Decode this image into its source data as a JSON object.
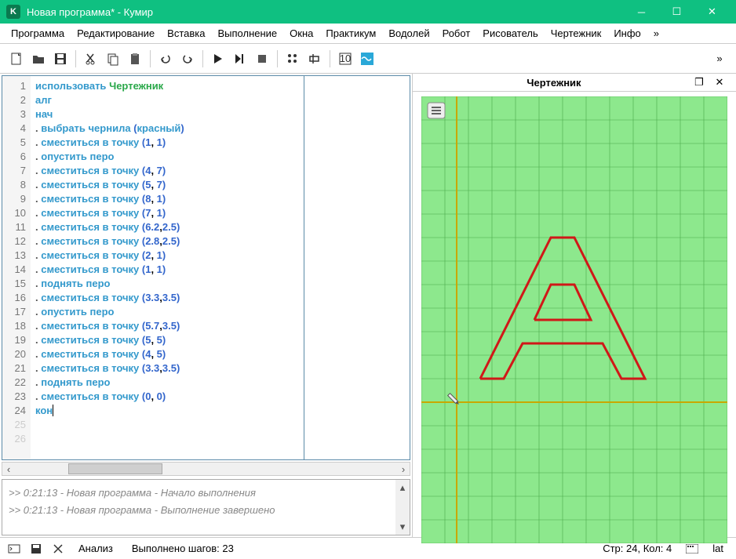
{
  "window": {
    "title": "Новая программа* - Кумир"
  },
  "menu": [
    "Программа",
    "Редактирование",
    "Вставка",
    "Выполнение",
    "Окна",
    "Практикум",
    "Водолей",
    "Робот",
    "Рисователь",
    "Чертежник",
    "Инфо",
    "»"
  ],
  "panel": {
    "title": "Чертежник"
  },
  "code_lines": [
    {
      "n": 1,
      "html": "<span class='kw'>использовать</span> <span class='kg'>Чертежник</span>"
    },
    {
      "n": 2,
      "html": "<span class='kw'>алг</span>"
    },
    {
      "n": 3,
      "html": "<span class='kw'>нач</span>"
    },
    {
      "n": 4,
      "html": "<span class='dot'>.</span> <span class='kw'>выбрать чернила</span> <span class='par'>(</span><span class='str'>красный</span><span class='par'>)</span>"
    },
    {
      "n": 5,
      "html": "<span class='dot'>.</span> <span class='kw'>сместиться в точку</span> <span class='par'>(</span><span class='num'>1</span>, <span class='num'>1</span><span class='par'>)</span>"
    },
    {
      "n": 6,
      "html": "<span class='dot'>.</span> <span class='kw'>опустить перо</span>"
    },
    {
      "n": 7,
      "html": "<span class='dot'>.</span> <span class='kw'>сместиться в точку</span> <span class='par'>(</span><span class='num'>4</span>, <span class='num'>7</span><span class='par'>)</span>"
    },
    {
      "n": 8,
      "html": "<span class='dot'>.</span> <span class='kw'>сместиться в точку</span> <span class='par'>(</span><span class='num'>5</span>, <span class='num'>7</span><span class='par'>)</span>"
    },
    {
      "n": 9,
      "html": "<span class='dot'>.</span> <span class='kw'>сместиться в точку</span> <span class='par'>(</span><span class='num'>8</span>, <span class='num'>1</span><span class='par'>)</span>"
    },
    {
      "n": 10,
      "html": "<span class='dot'>.</span> <span class='kw'>сместиться в точку</span> <span class='par'>(</span><span class='num'>7</span>, <span class='num'>1</span><span class='par'>)</span>"
    },
    {
      "n": 11,
      "html": "<span class='dot'>.</span> <span class='kw'>сместиться в точку</span> <span class='par'>(</span><span class='num'>6.2</span>,<span class='num'>2.5</span><span class='par'>)</span>"
    },
    {
      "n": 12,
      "html": "<span class='dot'>.</span> <span class='kw'>сместиться в точку</span> <span class='par'>(</span><span class='num'>2.8</span>,<span class='num'>2.5</span><span class='par'>)</span>"
    },
    {
      "n": 13,
      "html": "<span class='dot'>.</span> <span class='kw'>сместиться в точку</span> <span class='par'>(</span><span class='num'>2</span>, <span class='num'>1</span><span class='par'>)</span>"
    },
    {
      "n": 14,
      "html": "<span class='dot'>.</span> <span class='kw'>сместиться в точку</span> <span class='par'>(</span><span class='num'>1</span>, <span class='num'>1</span><span class='par'>)</span>"
    },
    {
      "n": 15,
      "html": "<span class='dot'>.</span> <span class='kw'>поднять перо</span>"
    },
    {
      "n": 16,
      "html": "<span class='dot'>.</span> <span class='kw'>сместиться в точку</span> <span class='par'>(</span><span class='num'>3.3</span>,<span class='num'>3.5</span><span class='par'>)</span>"
    },
    {
      "n": 17,
      "html": "<span class='dot'>.</span> <span class='kw'>опустить перо</span>"
    },
    {
      "n": 18,
      "html": "<span class='dot'>.</span> <span class='kw'>сместиться в точку</span> <span class='par'>(</span><span class='num'>5.7</span>,<span class='num'>3.5</span><span class='par'>)</span>"
    },
    {
      "n": 19,
      "html": "<span class='dot'>.</span> <span class='kw'>сместиться в точку</span> <span class='par'>(</span><span class='num'>5</span>, <span class='num'>5</span><span class='par'>)</span>"
    },
    {
      "n": 20,
      "html": "<span class='dot'>.</span> <span class='kw'>сместиться в точку</span> <span class='par'>(</span><span class='num'>4</span>, <span class='num'>5</span><span class='par'>)</span>"
    },
    {
      "n": 21,
      "html": "<span class='dot'>.</span> <span class='kw'>сместиться в точку</span> <span class='par'>(</span><span class='num'>3.3</span>,<span class='num'>3.5</span><span class='par'>)</span>"
    },
    {
      "n": 22,
      "html": "<span class='dot'>.</span> <span class='kw'>поднять перо</span>"
    },
    {
      "n": 23,
      "html": "<span class='dot'>.</span> <span class='kw'>сместиться в точку</span> <span class='par'>(</span><span class='num'>0</span>, <span class='num'>0</span><span class='par'>)</span>"
    },
    {
      "n": 24,
      "html": "<span class='kw'>кон</span><span class='cursor'></span>"
    },
    {
      "n": 25,
      "html": ""
    },
    {
      "n": 26,
      "html": ""
    }
  ],
  "console": {
    "line1": ">>  0:21:13 - Новая программа - Начало выполнения",
    "line2": ">>  0:21:13 - Новая программа - Выполнение завершено"
  },
  "status": {
    "analysis": "Анализ",
    "steps": "Выполнено шагов: 23",
    "pos": "Стр: 24, Кол: 4",
    "lang": "lat"
  },
  "drawing": {
    "color": "#d01818",
    "paths": [
      [
        [
          1,
          1
        ],
        [
          4,
          7
        ],
        [
          5,
          7
        ],
        [
          8,
          1
        ],
        [
          7,
          1
        ],
        [
          6.2,
          2.5
        ],
        [
          2.8,
          2.5
        ],
        [
          2,
          1
        ],
        [
          1,
          1
        ]
      ],
      [
        [
          3.3,
          3.5
        ],
        [
          5.7,
          3.5
        ],
        [
          5,
          5
        ],
        [
          4,
          5
        ],
        [
          3.3,
          3.5
        ]
      ]
    ],
    "pen_pos": [
      0,
      0
    ]
  }
}
